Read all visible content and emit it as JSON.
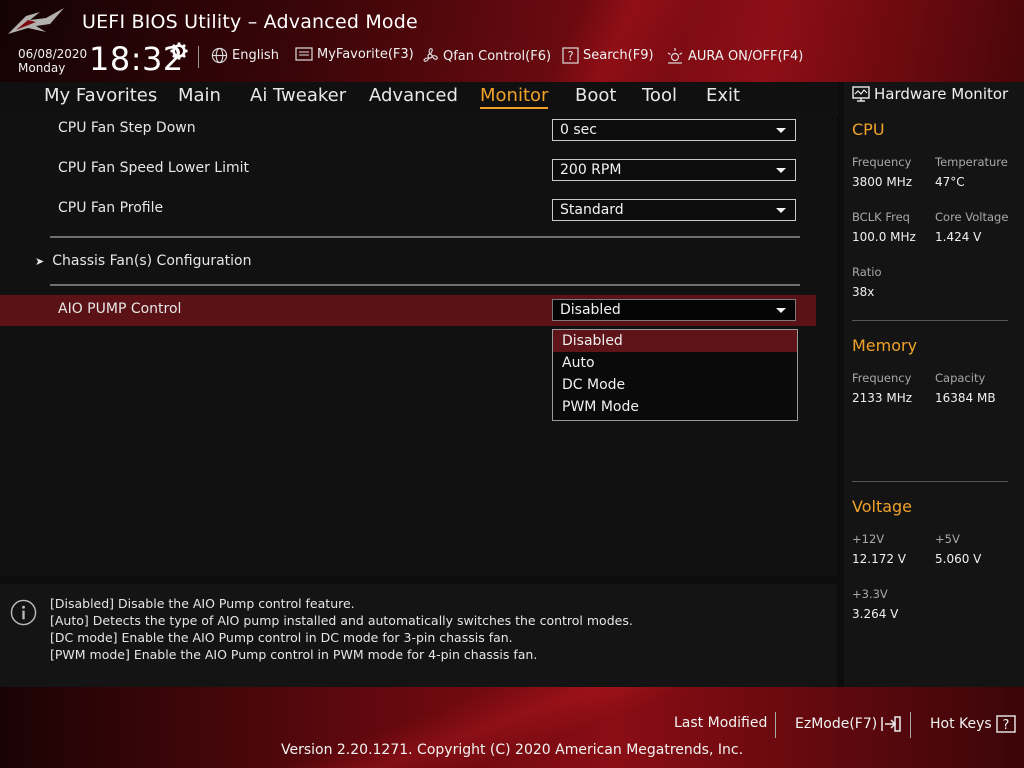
{
  "app": {
    "title": "UEFI BIOS Utility – Advanced Mode"
  },
  "clock": {
    "date": "06/08/2020",
    "day": "Monday",
    "time": "18:32"
  },
  "toolbar": [
    {
      "label": "English",
      "icon": "globe-icon"
    },
    {
      "label": "MyFavorite(F3)",
      "icon": "favorite-icon"
    },
    {
      "label": "Qfan Control(F6)",
      "icon": "fan-icon"
    },
    {
      "label": "Search(F9)",
      "icon": "search-icon"
    },
    {
      "label": "AURA ON/OFF(F4)",
      "icon": "aura-icon"
    }
  ],
  "nav": {
    "tabs": [
      "My Favorites",
      "Main",
      "Ai Tweaker",
      "Advanced",
      "Monitor",
      "Boot",
      "Tool",
      "Exit"
    ],
    "active": "Monitor"
  },
  "settings": {
    "step_down": {
      "label": "CPU Fan Step Down",
      "value": "0 sec"
    },
    "lower_limit": {
      "label": "CPU Fan Speed Lower Limit",
      "value": "200 RPM"
    },
    "profile": {
      "label": "CPU Fan Profile",
      "value": "Standard"
    },
    "chassis": {
      "label": "Chassis Fan(s) Configuration"
    },
    "aio": {
      "label": "AIO PUMP Control",
      "value": "Disabled"
    }
  },
  "dropdown": {
    "options": [
      "Disabled",
      "Auto",
      "DC Mode",
      "PWM Mode"
    ],
    "highlighted": "Disabled"
  },
  "help": {
    "lines": [
      "[Disabled] Disable the AIO Pump control feature.",
      "[Auto] Detects the type of AIO pump installed and automatically switches the control modes.",
      "[DC mode] Enable the AIO Pump control in DC mode for 3-pin chassis fan.",
      "[PWM mode] Enable the AIO Pump control in PWM mode for 4-pin chassis fan."
    ]
  },
  "hw": {
    "title": "Hardware Monitor",
    "cpu": {
      "title": "CPU",
      "frequency_label": "Frequency",
      "frequency": "3800 MHz",
      "temperature_label": "Temperature",
      "temperature": "47°C",
      "bclk_label": "BCLK Freq",
      "bclk": "100.0 MHz",
      "core_voltage_label": "Core Voltage",
      "core_voltage": "1.424 V",
      "ratio_label": "Ratio",
      "ratio": "38x"
    },
    "memory": {
      "title": "Memory",
      "frequency_label": "Frequency",
      "frequency": "2133 MHz",
      "capacity_label": "Capacity",
      "capacity": "16384 MB"
    },
    "voltage": {
      "title": "Voltage",
      "v12_label": "+12V",
      "v12": "12.172 V",
      "v5_label": "+5V",
      "v5": "5.060 V",
      "v33_label": "+3.3V",
      "v33": "3.264 V"
    }
  },
  "footer": {
    "last_modified": "Last Modified",
    "ezmode": "EzMode(F7)",
    "hotkeys": "Hot Keys",
    "version": "Version 2.20.1271. Copyright (C) 2020 American Megatrends, Inc."
  },
  "colors": {
    "accent": "#f0a22a",
    "selection": "#5a1216",
    "brand": "#8e0e16"
  }
}
